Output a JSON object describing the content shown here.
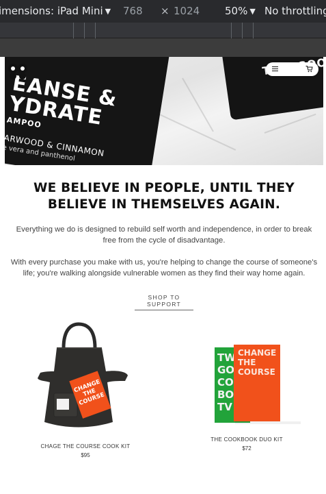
{
  "devtools": {
    "device_label": "imensions: iPad Mini",
    "width": "768",
    "times": "×",
    "height": "1024",
    "zoom": "50%",
    "throttle": "No throttling",
    "caret": "▼"
  },
  "hero": {
    "bottle_left": {
      "line1": "EANSE &",
      "line2": "YDRATE",
      "line3": "AMPOO",
      "line4": "ARWOOD & CINNAMON",
      "line5": "e vera and panthenol"
    },
    "bottle_right_brand": "TWO GOO"
  },
  "nav": {
    "menu_icon": "hamburger-icon",
    "cart_icon": "cart-icon"
  },
  "content": {
    "headline": "WE BELIEVE IN PEOPLE, UNTIL THEY BELIEVE IN THEMSELVES AGAIN.",
    "paragraph1": "Everything we do is designed to rebuild self worth and independence, in order to break free from the cycle of disadvantage.",
    "paragraph2": "With every purchase you make with us, you're helping to change the course of someone's life; you're walking alongside vulnerable women as they find their way home again.",
    "cta": "SHOP TO SUPPORT"
  },
  "products": [
    {
      "title": "CHAGE THE COURSE COOK KIT",
      "price": "$95",
      "book_cover_text": "CHANGE THE COURSE"
    },
    {
      "title": "THE COOKBOOK DUO KIT",
      "price": "$72",
      "green_book_text": "TWO GOOD COOKBOOK VOL",
      "orange_book_text": "CHANGE THE COURSE"
    }
  ],
  "colors": {
    "devtools_bg": "#292a2d",
    "orange": "#f1511b",
    "green": "#22a33a",
    "apron": "#2b2b2b"
  }
}
